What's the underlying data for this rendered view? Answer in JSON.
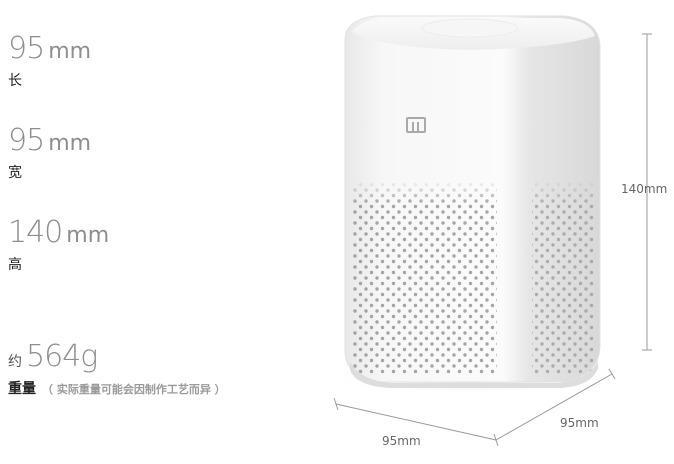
{
  "specs": [
    {
      "value": "95",
      "unit": "mm",
      "label": "长"
    },
    {
      "value": "95",
      "unit": "mm",
      "label": "宽"
    },
    {
      "value": "140",
      "unit": "mm",
      "label": "高"
    }
  ],
  "weight": {
    "prefix": "约",
    "value": "564g",
    "label": "重量",
    "note": "（ 实际重量可能会因制作工艺而异 ）"
  },
  "dimensions": {
    "height": "140mm",
    "width": "95mm",
    "depth": "95mm"
  },
  "colors": {
    "speaker_body": "#f4f4f4",
    "speaker_shadow": "#dcdcdc",
    "grille_dot": "#8a8a8a",
    "dim_line": "#999999"
  },
  "logo_icon": "mi-logo-icon"
}
